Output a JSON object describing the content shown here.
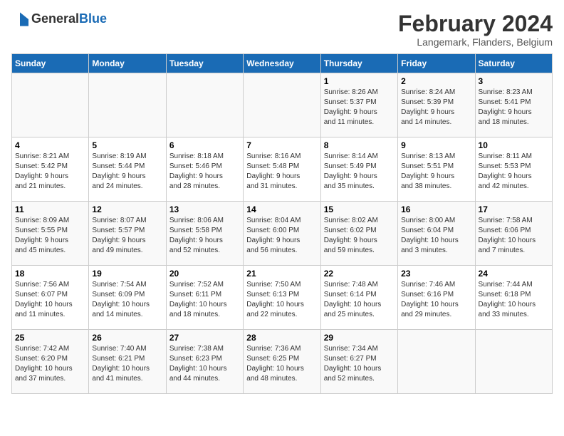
{
  "header": {
    "logo_general": "General",
    "logo_blue": "Blue",
    "main_title": "February 2024",
    "subtitle": "Langemark, Flanders, Belgium"
  },
  "calendar": {
    "days_of_week": [
      "Sunday",
      "Monday",
      "Tuesday",
      "Wednesday",
      "Thursday",
      "Friday",
      "Saturday"
    ],
    "weeks": [
      [
        {
          "day": "",
          "detail": ""
        },
        {
          "day": "",
          "detail": ""
        },
        {
          "day": "",
          "detail": ""
        },
        {
          "day": "",
          "detail": ""
        },
        {
          "day": "1",
          "detail": "Sunrise: 8:26 AM\nSunset: 5:37 PM\nDaylight: 9 hours\nand 11 minutes."
        },
        {
          "day": "2",
          "detail": "Sunrise: 8:24 AM\nSunset: 5:39 PM\nDaylight: 9 hours\nand 14 minutes."
        },
        {
          "day": "3",
          "detail": "Sunrise: 8:23 AM\nSunset: 5:41 PM\nDaylight: 9 hours\nand 18 minutes."
        }
      ],
      [
        {
          "day": "4",
          "detail": "Sunrise: 8:21 AM\nSunset: 5:42 PM\nDaylight: 9 hours\nand 21 minutes."
        },
        {
          "day": "5",
          "detail": "Sunrise: 8:19 AM\nSunset: 5:44 PM\nDaylight: 9 hours\nand 24 minutes."
        },
        {
          "day": "6",
          "detail": "Sunrise: 8:18 AM\nSunset: 5:46 PM\nDaylight: 9 hours\nand 28 minutes."
        },
        {
          "day": "7",
          "detail": "Sunrise: 8:16 AM\nSunset: 5:48 PM\nDaylight: 9 hours\nand 31 minutes."
        },
        {
          "day": "8",
          "detail": "Sunrise: 8:14 AM\nSunset: 5:49 PM\nDaylight: 9 hours\nand 35 minutes."
        },
        {
          "day": "9",
          "detail": "Sunrise: 8:13 AM\nSunset: 5:51 PM\nDaylight: 9 hours\nand 38 minutes."
        },
        {
          "day": "10",
          "detail": "Sunrise: 8:11 AM\nSunset: 5:53 PM\nDaylight: 9 hours\nand 42 minutes."
        }
      ],
      [
        {
          "day": "11",
          "detail": "Sunrise: 8:09 AM\nSunset: 5:55 PM\nDaylight: 9 hours\nand 45 minutes."
        },
        {
          "day": "12",
          "detail": "Sunrise: 8:07 AM\nSunset: 5:57 PM\nDaylight: 9 hours\nand 49 minutes."
        },
        {
          "day": "13",
          "detail": "Sunrise: 8:06 AM\nSunset: 5:58 PM\nDaylight: 9 hours\nand 52 minutes."
        },
        {
          "day": "14",
          "detail": "Sunrise: 8:04 AM\nSunset: 6:00 PM\nDaylight: 9 hours\nand 56 minutes."
        },
        {
          "day": "15",
          "detail": "Sunrise: 8:02 AM\nSunset: 6:02 PM\nDaylight: 9 hours\nand 59 minutes."
        },
        {
          "day": "16",
          "detail": "Sunrise: 8:00 AM\nSunset: 6:04 PM\nDaylight: 10 hours\nand 3 minutes."
        },
        {
          "day": "17",
          "detail": "Sunrise: 7:58 AM\nSunset: 6:06 PM\nDaylight: 10 hours\nand 7 minutes."
        }
      ],
      [
        {
          "day": "18",
          "detail": "Sunrise: 7:56 AM\nSunset: 6:07 PM\nDaylight: 10 hours\nand 11 minutes."
        },
        {
          "day": "19",
          "detail": "Sunrise: 7:54 AM\nSunset: 6:09 PM\nDaylight: 10 hours\nand 14 minutes."
        },
        {
          "day": "20",
          "detail": "Sunrise: 7:52 AM\nSunset: 6:11 PM\nDaylight: 10 hours\nand 18 minutes."
        },
        {
          "day": "21",
          "detail": "Sunrise: 7:50 AM\nSunset: 6:13 PM\nDaylight: 10 hours\nand 22 minutes."
        },
        {
          "day": "22",
          "detail": "Sunrise: 7:48 AM\nSunset: 6:14 PM\nDaylight: 10 hours\nand 25 minutes."
        },
        {
          "day": "23",
          "detail": "Sunrise: 7:46 AM\nSunset: 6:16 PM\nDaylight: 10 hours\nand 29 minutes."
        },
        {
          "day": "24",
          "detail": "Sunrise: 7:44 AM\nSunset: 6:18 PM\nDaylight: 10 hours\nand 33 minutes."
        }
      ],
      [
        {
          "day": "25",
          "detail": "Sunrise: 7:42 AM\nSunset: 6:20 PM\nDaylight: 10 hours\nand 37 minutes."
        },
        {
          "day": "26",
          "detail": "Sunrise: 7:40 AM\nSunset: 6:21 PM\nDaylight: 10 hours\nand 41 minutes."
        },
        {
          "day": "27",
          "detail": "Sunrise: 7:38 AM\nSunset: 6:23 PM\nDaylight: 10 hours\nand 44 minutes."
        },
        {
          "day": "28",
          "detail": "Sunrise: 7:36 AM\nSunset: 6:25 PM\nDaylight: 10 hours\nand 48 minutes."
        },
        {
          "day": "29",
          "detail": "Sunrise: 7:34 AM\nSunset: 6:27 PM\nDaylight: 10 hours\nand 52 minutes."
        },
        {
          "day": "",
          "detail": ""
        },
        {
          "day": "",
          "detail": ""
        }
      ]
    ]
  }
}
